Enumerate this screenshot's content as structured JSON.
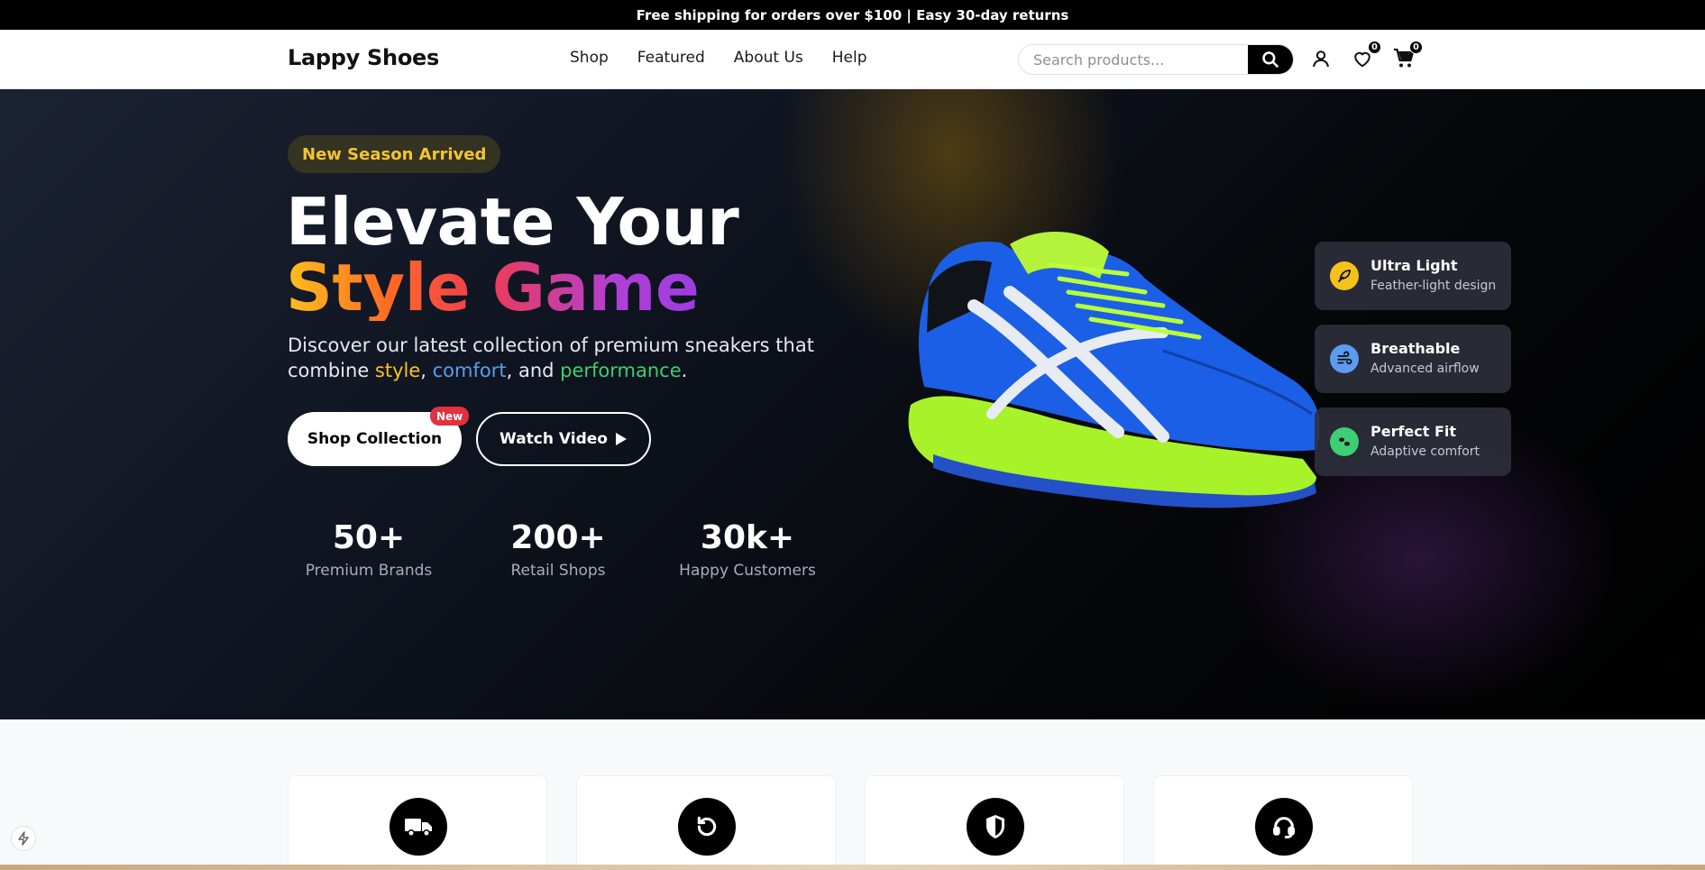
{
  "announcement": "Free shipping for orders over $100 | Easy 30-day returns",
  "header": {
    "logo": "Lappy Shoes",
    "menu": [
      "Shop",
      "Featured",
      "About Us",
      "Help"
    ],
    "search_placeholder": "Search products...",
    "wishlist_count": "0",
    "cart_count": "0",
    "icons": [
      "search-icon",
      "user-icon",
      "heart-icon",
      "cart-icon"
    ]
  },
  "hero": {
    "badge": "New Season Arrived",
    "title_line1": "Elevate Your",
    "title_line2": "Style Game",
    "desc_prefix": "Discover our latest collection of premium sneakers that combine ",
    "desc_style": "style",
    "desc_sep1": ", ",
    "desc_comfort": "comfort",
    "desc_sep2": ", and ",
    "desc_performance": "performance",
    "desc_suffix": ".",
    "primary_button": "Shop Collection",
    "primary_tag": "New",
    "secondary_button": "Watch Video",
    "stats": [
      {
        "number": "50+",
        "label": "Premium Brands"
      },
      {
        "number": "200+",
        "label": "Retail Shops"
      },
      {
        "number": "30k+",
        "label": "Happy Customers"
      }
    ],
    "features": [
      {
        "title": "Ultra Light",
        "subtitle": "Feather-light design",
        "icon": "feather-icon",
        "color": "#f5c21b"
      },
      {
        "title": "Breathable",
        "subtitle": "Advanced airflow",
        "icon": "wind-icon",
        "color": "#5b9cf0"
      },
      {
        "title": "Perfect Fit",
        "subtitle": "Adaptive comfort",
        "icon": "footprints-icon",
        "color": "#3ccf73"
      }
    ]
  },
  "services": {
    "icons": [
      "truck-icon",
      "return-icon",
      "shield-icon",
      "headset-icon"
    ]
  },
  "colors": {
    "accent_yellow": "#f4c430",
    "accent_red": "#e3303f",
    "accent_blue": "#5b9cf0",
    "accent_green": "#3ccf73"
  }
}
